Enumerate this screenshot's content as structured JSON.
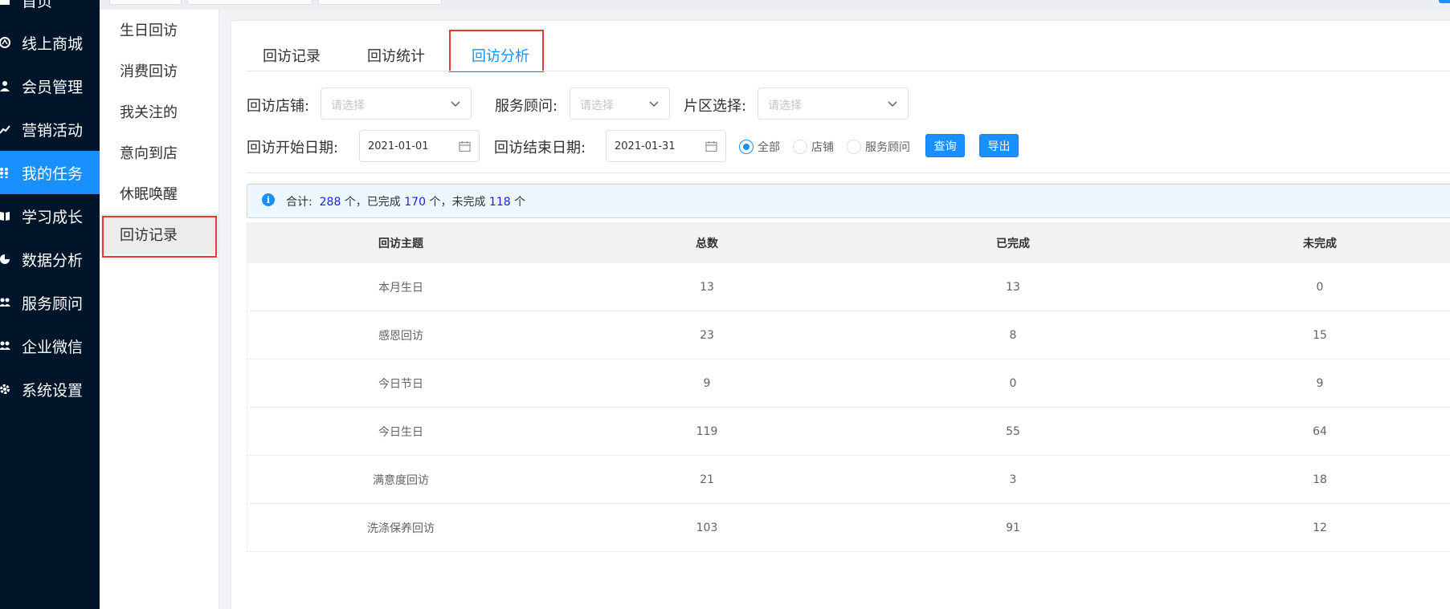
{
  "nav": {
    "items": [
      {
        "label": "首页",
        "icon": "home-icon",
        "active": false
      },
      {
        "label": "线上商城",
        "icon": "shop-icon",
        "active": false
      },
      {
        "label": "会员管理",
        "icon": "user-icon",
        "active": false
      },
      {
        "label": "营销活动",
        "icon": "trend-icon",
        "active": false
      },
      {
        "label": "我的任务",
        "icon": "grid-icon",
        "active": true
      },
      {
        "label": "学习成长",
        "icon": "book-icon",
        "active": false
      },
      {
        "label": "数据分析",
        "icon": "pie-chart-icon",
        "active": false
      },
      {
        "label": "服务顾问",
        "icon": "users-icon",
        "active": false
      },
      {
        "label": "企业微信",
        "icon": "users-icon",
        "active": false
      },
      {
        "label": "系统设置",
        "icon": "gear-icon",
        "active": false
      }
    ]
  },
  "sub_menu": {
    "items": [
      "生日回访",
      "消费回访",
      "我关注的",
      "意向到店",
      "休眠唤醒",
      "回访记录"
    ],
    "active_index": 5
  },
  "tabs": [
    "回访记录",
    "回访统计",
    "回访分析"
  ],
  "active_tab": 2,
  "filters": {
    "store_label": "回访店铺:",
    "store_placeholder": "请选择",
    "advisor_label": "服务顾问:",
    "advisor_placeholder": "请选择",
    "area_label": "片区选择:",
    "area_placeholder": "请选择",
    "start_label": "回访开始日期:",
    "start_value": "2021-01-01",
    "end_label": "回访结束日期:",
    "end_value": "2021-01-31",
    "radios": [
      "全部",
      "店铺",
      "服务顾问"
    ],
    "radio_selected": 0,
    "query_button": "查询",
    "export_button": "导出"
  },
  "summary": {
    "prefix": "合计:",
    "total": "288",
    "unit1": "个，已完成",
    "done": "170",
    "unit2": "个，未完成",
    "undone": "118",
    "unit3": "个"
  },
  "table": {
    "headers": [
      "回访主题",
      "总数",
      "已完成",
      "未完成"
    ],
    "rows": [
      [
        "本月生日",
        "13",
        "13",
        "0"
      ],
      [
        "感恩回访",
        "23",
        "8",
        "15"
      ],
      [
        "今日节日",
        "9",
        "0",
        "9"
      ],
      [
        "今日生日",
        "119",
        "55",
        "64"
      ],
      [
        "满意度回访",
        "21",
        "3",
        "18"
      ],
      [
        "洗涤保养回访",
        "103",
        "91",
        "12"
      ]
    ]
  },
  "colors": {
    "nav_bg": "#001529",
    "accent": "#1890ff",
    "highlight_box": "#e53935"
  }
}
